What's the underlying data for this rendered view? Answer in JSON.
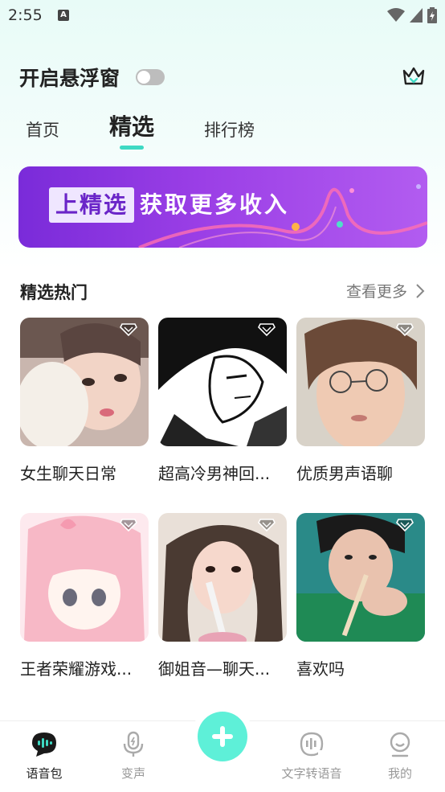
{
  "status": {
    "time": "2:55",
    "notif_icon": "A"
  },
  "header": {
    "float_label": "开启悬浮窗",
    "float_toggle_on": false,
    "vip_icon": "crown-icon"
  },
  "tabs": [
    {
      "label": "首页",
      "active": false
    },
    {
      "label": "精选",
      "active": true
    },
    {
      "label": "排行榜",
      "active": false
    }
  ],
  "banner": {
    "tag": "上精选",
    "text": "获取更多收入"
  },
  "section": {
    "title": "精选热门",
    "more": "查看更多"
  },
  "cards": [
    {
      "title": "女生聊天日常"
    },
    {
      "title": "超高冷男神回..."
    },
    {
      "title": "优质男声语聊"
    },
    {
      "title": "王者荣耀游戏..."
    },
    {
      "title": "御姐音—聊天..."
    },
    {
      "title": "喜欢吗"
    }
  ],
  "nav": [
    {
      "label": "语音包",
      "active": true
    },
    {
      "label": "变声",
      "active": false
    },
    {
      "label": "文字转语音",
      "active": false
    },
    {
      "label": "我的",
      "active": false
    }
  ],
  "colors": {
    "accent": "#3ed9c3",
    "fab": "#5ef0d8",
    "banner": "#9b3fe6"
  }
}
